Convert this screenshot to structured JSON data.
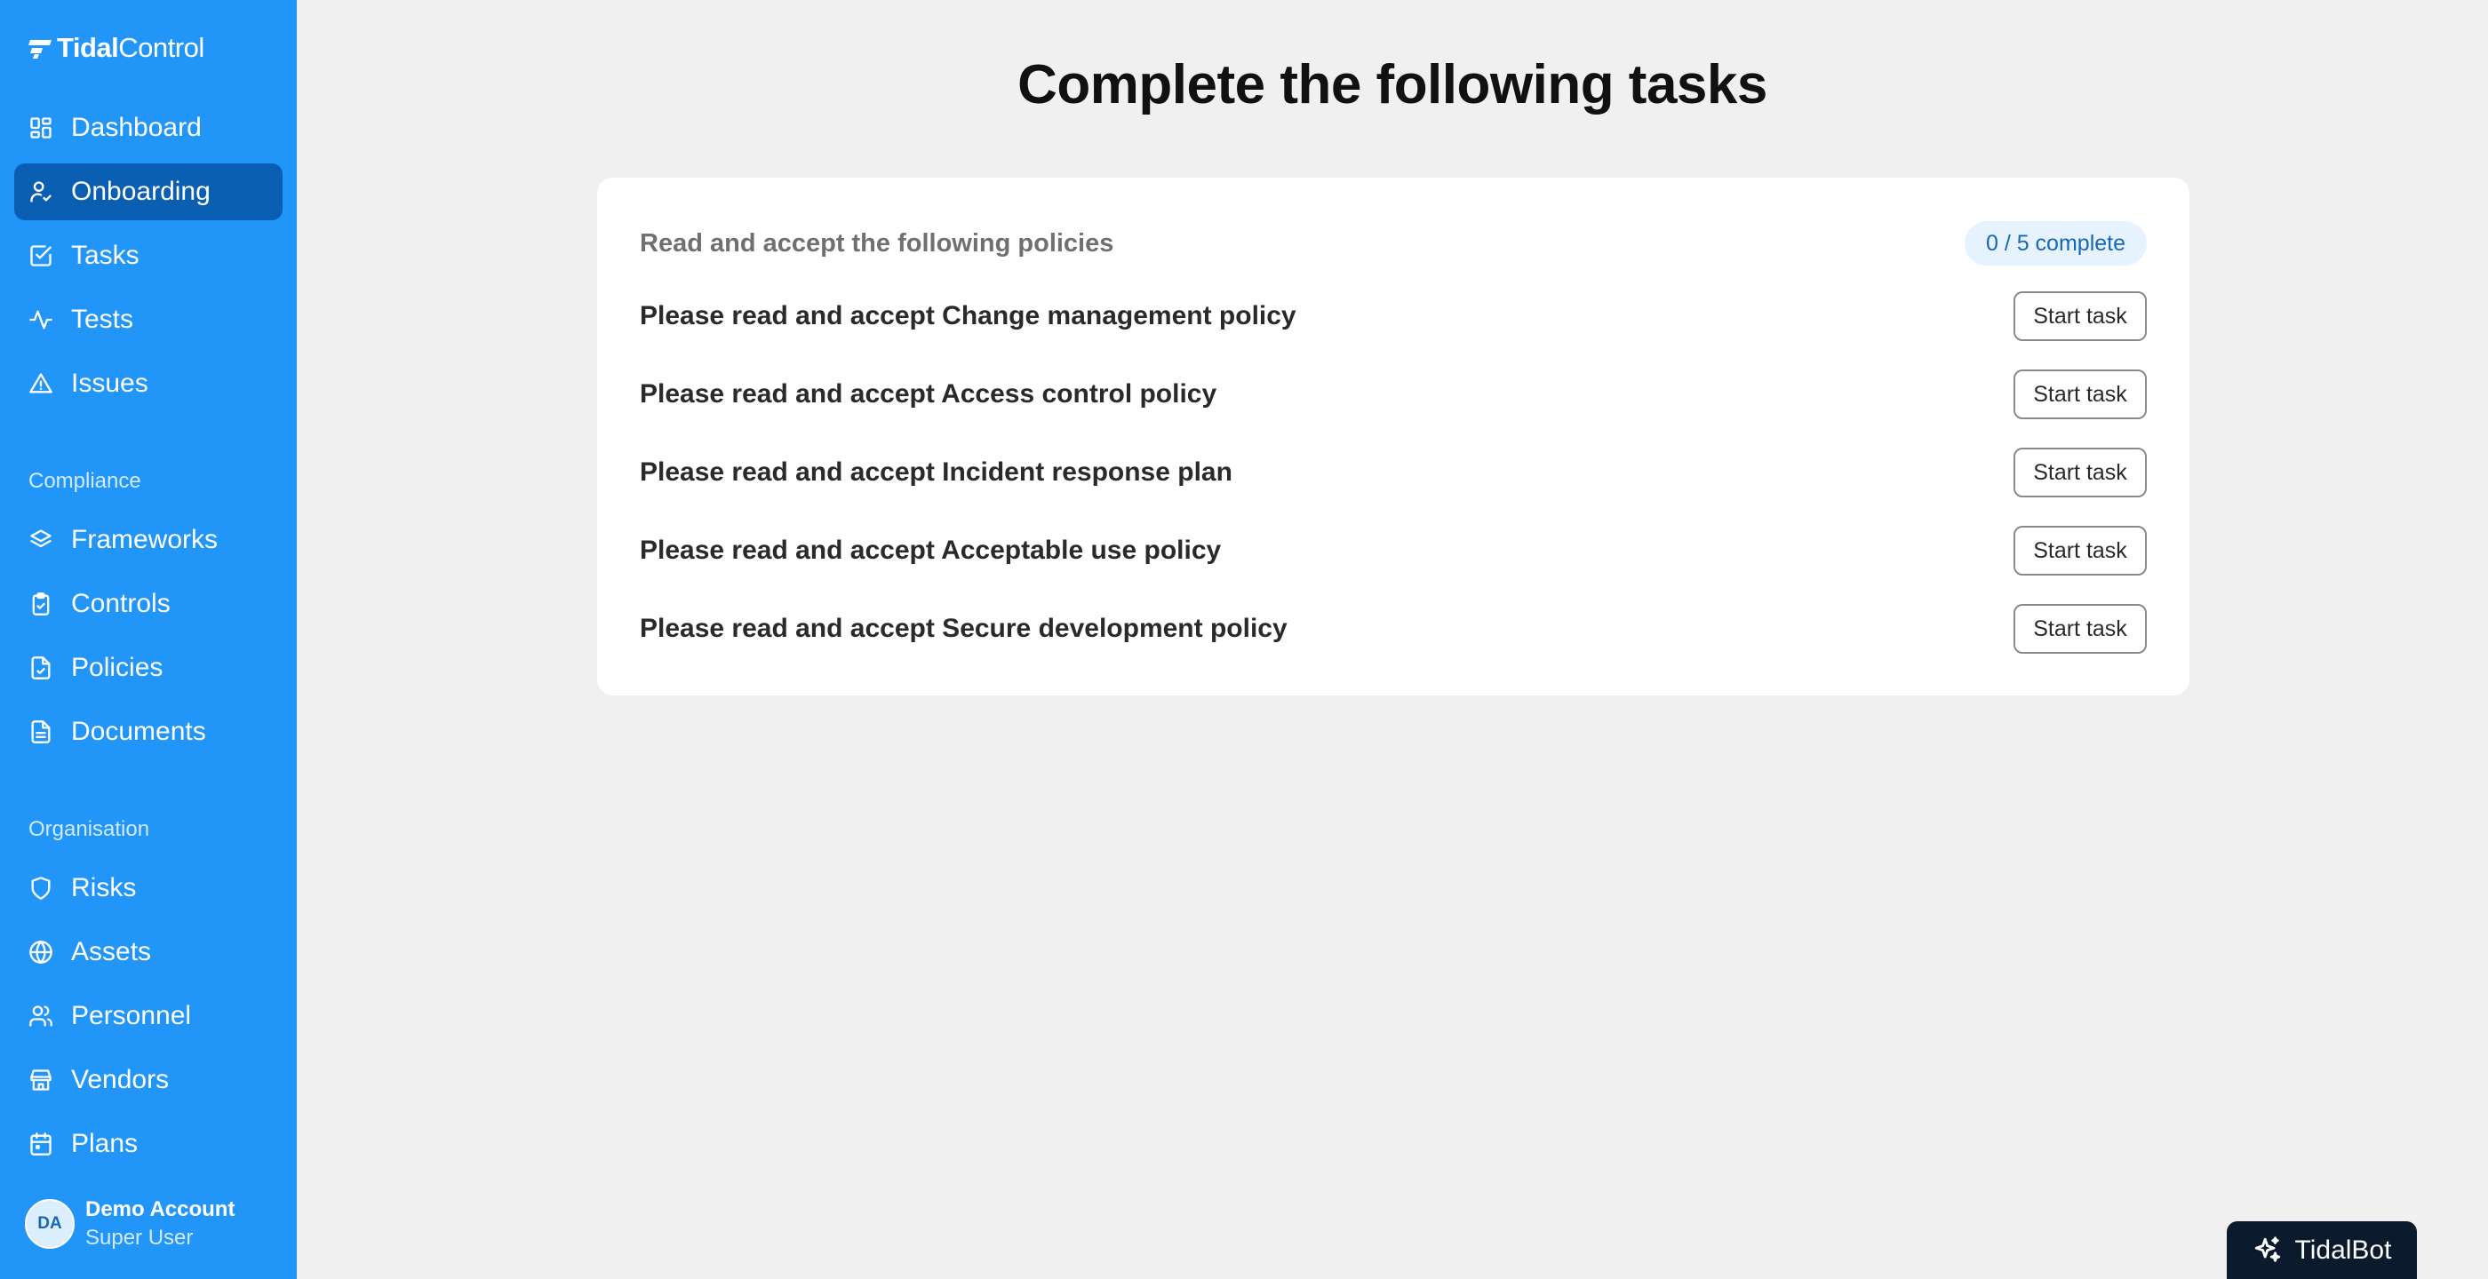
{
  "brand": {
    "name_bold": "Tidal",
    "name_light": "Control"
  },
  "sidebar": {
    "main_items": [
      {
        "label": "Dashboard",
        "icon": "dashboard-icon"
      },
      {
        "label": "Onboarding",
        "icon": "user-check-icon",
        "active": true
      },
      {
        "label": "Tasks",
        "icon": "checkbox-icon"
      },
      {
        "label": "Tests",
        "icon": "activity-icon"
      },
      {
        "label": "Issues",
        "icon": "warning-icon"
      }
    ],
    "compliance_label": "Compliance",
    "compliance_items": [
      {
        "label": "Frameworks",
        "icon": "layers-icon"
      },
      {
        "label": "Controls",
        "icon": "clipboard-check-icon"
      },
      {
        "label": "Policies",
        "icon": "file-check-icon"
      },
      {
        "label": "Documents",
        "icon": "file-text-icon"
      }
    ],
    "organisation_label": "Organisation",
    "organisation_items": [
      {
        "label": "Risks",
        "icon": "shield-icon"
      },
      {
        "label": "Assets",
        "icon": "globe-icon"
      },
      {
        "label": "Personnel",
        "icon": "users-icon"
      },
      {
        "label": "Vendors",
        "icon": "store-icon"
      },
      {
        "label": "Plans",
        "icon": "calendar-icon"
      }
    ],
    "user": {
      "initials": "DA",
      "name": "Demo Account",
      "role": "Super User"
    }
  },
  "main": {
    "title": "Complete the following tasks",
    "card": {
      "heading": "Read and accept the following policies",
      "progress": "0 / 5 complete",
      "progress_completed": 0,
      "progress_total": 5,
      "tasks": [
        {
          "text": "Please read and accept Change management policy",
          "button": "Start task"
        },
        {
          "text": "Please read and accept Access control policy",
          "button": "Start task"
        },
        {
          "text": "Please read and accept Incident response plan",
          "button": "Start task"
        },
        {
          "text": "Please read and accept Acceptable use policy",
          "button": "Start task"
        },
        {
          "text": "Please read and accept Secure development policy",
          "button": "Start task"
        }
      ]
    }
  },
  "bot": {
    "label": "TidalBot",
    "icon": "sparkles-icon"
  },
  "colors": {
    "sidebar_bg": "#2196f8",
    "sidebar_active": "#0b5fb3",
    "page_bg": "#f0f0f0",
    "badge_bg": "#e6f3fe",
    "badge_text": "#1767b8",
    "bot_bg": "#0b1a2c"
  }
}
